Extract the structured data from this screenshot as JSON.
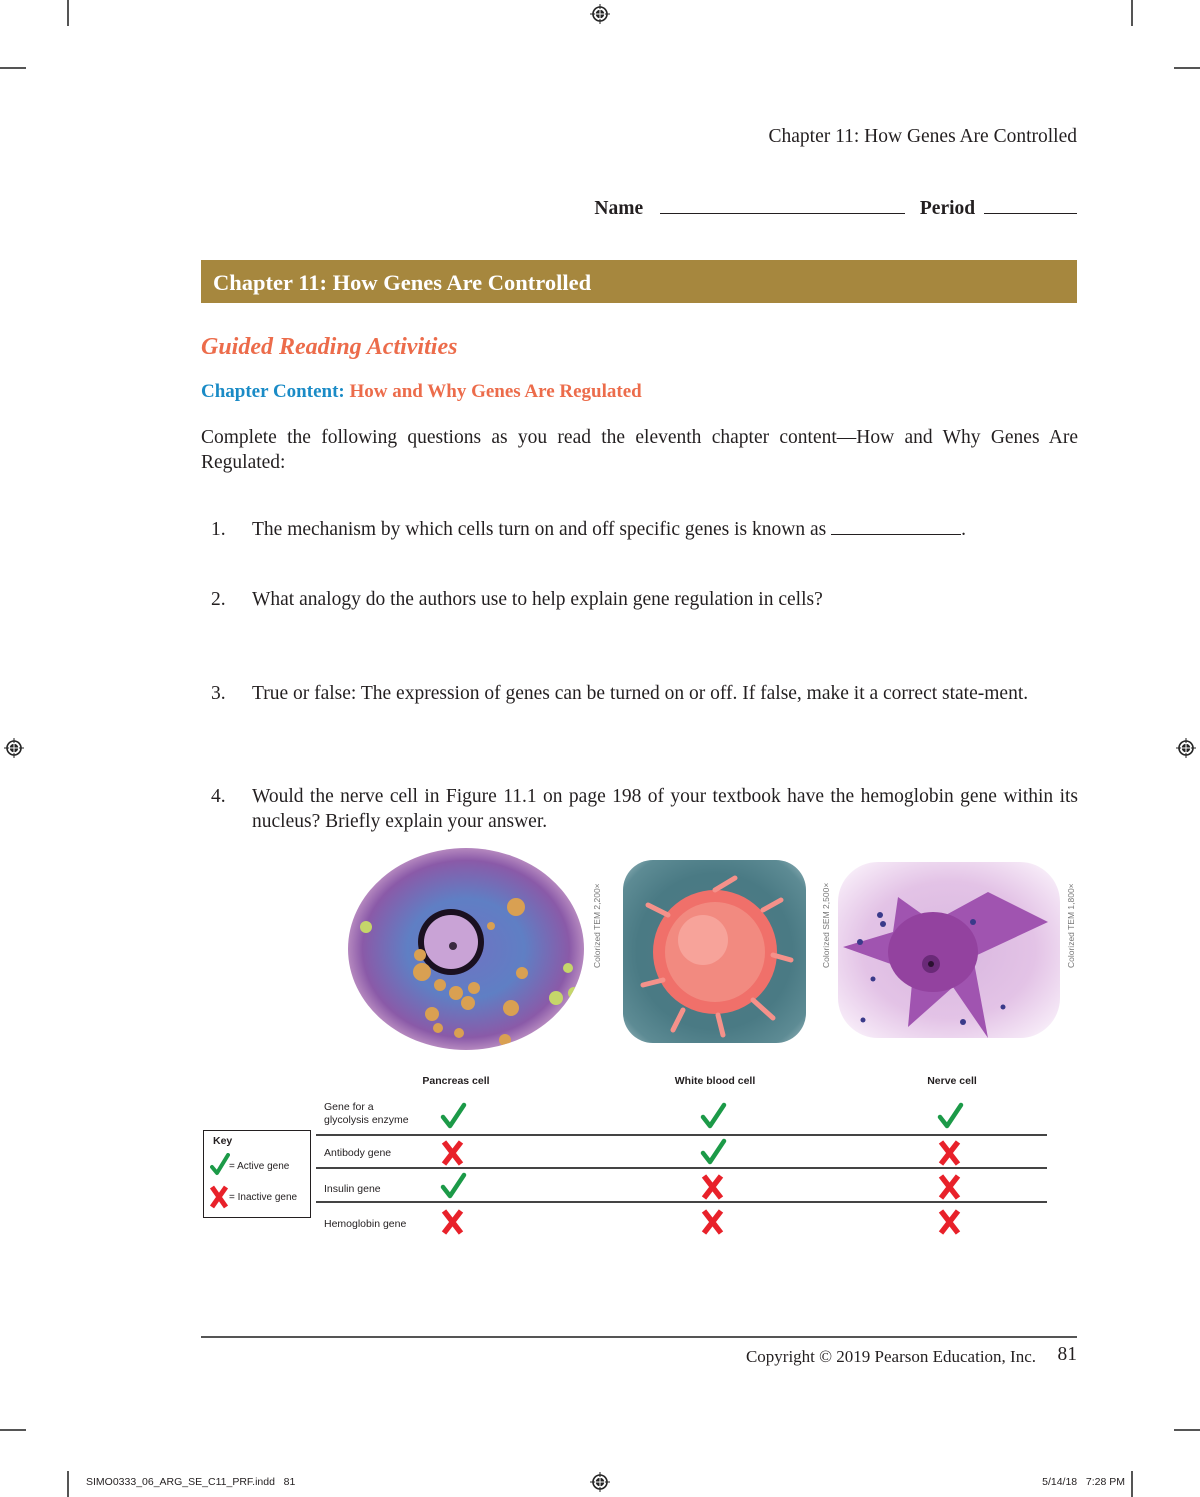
{
  "running_head": "Chapter 11: How Genes Are Controlled",
  "student_fields": {
    "name_label": "Name",
    "period_label": "Period"
  },
  "banner": {
    "title": "Chapter 11: How Genes Are Controlled",
    "color": "#a6873e"
  },
  "subtitle": "Guided Reading Activities",
  "content_heading": {
    "label": "Chapter Content:",
    "value": "How and Why Genes Are Regulated",
    "label_color": "#1a8bc6",
    "value_color": "#ec6c4b"
  },
  "intro": "Complete the following questions as you read the eleventh chapter content—How and Why Genes Are Regulated:",
  "questions": [
    {
      "number": "1.",
      "text": "The mechanism by which cells turn on and off specific genes is known as",
      "suffix": "."
    },
    {
      "number": "2.",
      "text": "What analogy do the authors use to help explain gene regulation in cells?"
    },
    {
      "number": "3.",
      "text": "True or false: The expression of genes can be turned on or off. If false, make it a correct state-ment."
    },
    {
      "number": "4.",
      "text": "Would the nerve cell in Figure 11.1 on page 198 of your textbook have the hemoglobin gene within its nucleus? Briefly explain your answer."
    }
  ],
  "figure": {
    "cells": [
      {
        "name": "Pancreas cell",
        "caption": "Colorized TEM 2,200×"
      },
      {
        "name": "White blood cell",
        "caption": "Colorized SEM 2,500×"
      },
      {
        "name": "Nerve cell",
        "caption": "Colorized TEM 1,800×"
      }
    ],
    "genes": [
      {
        "label_lines": [
          "Gene for a",
          "glycolysis enzyme"
        ],
        "states": [
          "active",
          "active",
          "active"
        ]
      },
      {
        "label_lines": [
          "Antibody gene"
        ],
        "states": [
          "inactive",
          "active",
          "inactive"
        ]
      },
      {
        "label_lines": [
          "Insulin gene"
        ],
        "states": [
          "active",
          "inactive",
          "inactive"
        ]
      },
      {
        "label_lines": [
          "Hemoglobin gene"
        ],
        "states": [
          "inactive",
          "inactive",
          "inactive"
        ]
      }
    ],
    "key": {
      "title": "Key",
      "active_label": "= Active gene",
      "inactive_label": "= Inactive gene",
      "active_color": "#1c9a48",
      "inactive_color": "#e8212a"
    }
  },
  "footer": {
    "copyright": "Copyright © 2019 Pearson Education, Inc.",
    "page_number": "81"
  },
  "slug": {
    "file": "SIMO0333_06_ARG_SE_C11_PRF.indd   81",
    "timestamp": "5/14/18   7:28 PM"
  }
}
